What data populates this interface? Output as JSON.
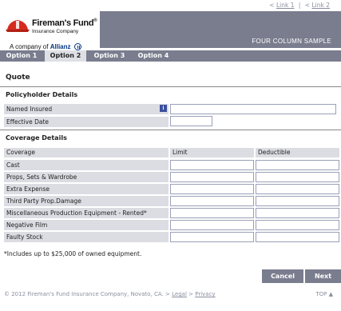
{
  "top_links": [
    "Link 1",
    "Link 2"
  ],
  "top_link_prefix": "<",
  "logo": {
    "brand": "Fireman's Fund",
    "registered": "®",
    "subtitle": "Insurance Company",
    "company_of": "A company of",
    "parent": "Allianz"
  },
  "header_label": "FOUR COLUMN SAMPLE",
  "tabs": [
    "Option 1",
    "Option 2",
    "Option 3",
    "Option 4"
  ],
  "active_tab": "Option 2",
  "page_title": "Quote",
  "policyholder": {
    "heading": "Policyholder Details",
    "fields": [
      {
        "label": "Named Insured",
        "value": ""
      },
      {
        "label": "Effective Date",
        "value": ""
      }
    ],
    "info_icon_glyph": "i"
  },
  "coverage": {
    "heading": "Coverage Details",
    "columns": [
      "Coverage",
      "Limit",
      "Deductible"
    ],
    "rows": [
      {
        "label": "Cast",
        "limit": "",
        "deductible": ""
      },
      {
        "label": "Props, Sets & Wardrobe",
        "limit": "",
        "deductible": ""
      },
      {
        "label": "Extra Expense",
        "limit": "",
        "deductible": ""
      },
      {
        "label": "Third Party Prop.Damage",
        "limit": "",
        "deductible": ""
      },
      {
        "label": "Miscellaneous Production Equipment - Rented*",
        "limit": "",
        "deductible": ""
      },
      {
        "label": "Negative Film",
        "limit": "",
        "deductible": ""
      },
      {
        "label": "Faulty Stock",
        "limit": "",
        "deductible": ""
      }
    ]
  },
  "footnote": "*Includes up to $25,000 of owned equipment.",
  "buttons": {
    "cancel": "Cancel",
    "next": "Next"
  },
  "footer": {
    "copyright": "© 2012 Fireman's Fund Insurance Company, Novato, CA. > ",
    "legal": "Legal",
    "sep": " > ",
    "privacy": "Privacy"
  },
  "back_to_top": "TOP ▲",
  "colors": {
    "header_gray": "#7a7d8e",
    "label_bg": "#dcdde3",
    "active_tab_bg": "#dfe0e6",
    "field_border": "#9aa0b8",
    "info_icon": "#3a4f9e",
    "logo_hat_red": "#d52b1e"
  }
}
